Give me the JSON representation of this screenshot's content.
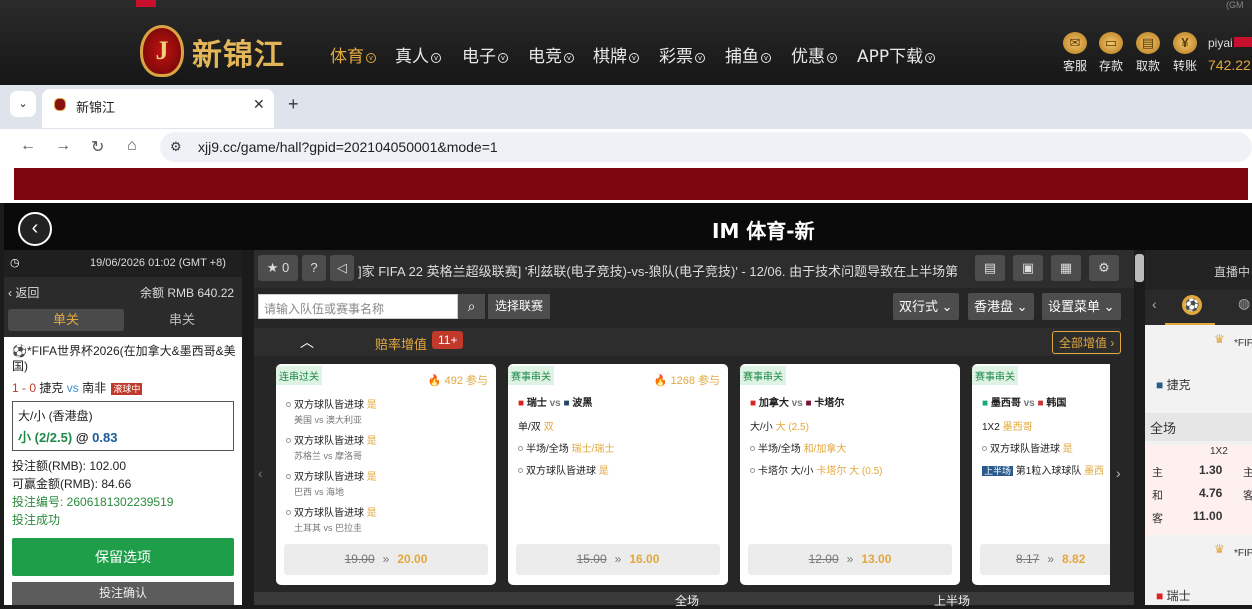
{
  "site": {
    "logo_letter": "J",
    "logo_text": "新锦江",
    "nav": [
      {
        "label": "体育"
      },
      {
        "label": "真人"
      },
      {
        "label": "电子"
      },
      {
        "label": "电竞"
      },
      {
        "label": "棋牌"
      },
      {
        "label": "彩票"
      },
      {
        "label": "捕鱼"
      },
      {
        "label": "优惠"
      },
      {
        "label": "APP下载"
      }
    ],
    "tools": [
      {
        "label": "客服"
      },
      {
        "label": "存款"
      },
      {
        "label": "取款"
      },
      {
        "label": "转账"
      }
    ],
    "user": "piyai",
    "balance": "742.22",
    "corner": "(GM"
  },
  "browser": {
    "tab_title": "新锦江",
    "url": "xjj9.cc/game/hall?gpid=202104050001&mode=1"
  },
  "im": {
    "title": "IM 体育-新"
  },
  "left": {
    "datetime": "19/06/2026 01:02 (GMT +8)",
    "back": "返回",
    "balance": "余额 RMB 640.22",
    "tab_single": "单关",
    "tab_parlay": "串关",
    "match": "*FIFA世界杯2026(在加拿大&墨西哥&美国)",
    "score": "1 - 0",
    "home": "捷克",
    "vs": "vs",
    "away": "南非",
    "live": "滚球中",
    "market": "大/小 (香港盘)",
    "selection": "小 (2/2.5)",
    "at": "@",
    "odds": "0.83",
    "stake": "投注额(RMB): 102.00",
    "win": "可赢金额(RMB): 84.66",
    "bet_no": "投注编号: 2606181302239519",
    "status": "投注成功",
    "keep": "保留选项",
    "confirm": "投注确认"
  },
  "main": {
    "fav_count": "0",
    "marquee": "]家 FIFA 22 英格兰超级联赛] '利兹联(电子竞技)-vs-狼队(电子竞技)' - 12/06. 由于技术问题导致在上半场第",
    "search_placeholder": "请输入队伍或赛事名称",
    "league_btn": "选择联赛",
    "view_dd": "双行式",
    "odds_dd": "香港盘",
    "settings_dd": "设置菜单",
    "boost_label": "赔率增值",
    "boost_count": "11+",
    "all_boost": "全部增值",
    "cards": [
      {
        "tag": "连串过关",
        "hot": "492 参与",
        "items": [
          {
            "t": "双方球队皆进球",
            "y": "是",
            "sub": "美国 vs 澳大利亚"
          },
          {
            "t": "双方球队皆进球",
            "y": "是",
            "sub": "苏格兰 vs 摩洛哥"
          },
          {
            "t": "双方球队皆进球",
            "y": "是",
            "sub": "巴西 vs 海地"
          },
          {
            "t": "双方球队皆进球",
            "y": "是",
            "sub": "土耳其 vs 巴拉圭"
          }
        ],
        "old": "19.00",
        "new": "20.00"
      },
      {
        "tag": "赛事串关",
        "hot": "1268 参与",
        "home": "瑞士",
        "away": "波黑",
        "items": [
          {
            "t": "单/双",
            "y": "双"
          },
          {
            "t": "半场/全场",
            "y": "瑞士/瑞士"
          },
          {
            "t": "双方球队皆进球",
            "y": "是"
          }
        ],
        "old": "15.00",
        "new": "16.00"
      },
      {
        "tag": "赛事串关",
        "home": "加拿大",
        "away": "卡塔尔",
        "items": [
          {
            "t": "大/小",
            "y": "大 (2.5)"
          },
          {
            "t": "半场/全场",
            "y": "和/加拿大"
          },
          {
            "t": "卡塔尔 大/小",
            "y": "卡塔尔 大 (0.5)"
          }
        ],
        "old": "12.00",
        "new": "13.00"
      },
      {
        "tag": "赛事串关",
        "home": "墨西哥",
        "away": "韩国",
        "items": [
          {
            "t": "1X2",
            "y": "墨西哥"
          },
          {
            "t": "双方球队皆进球",
            "y": "是"
          },
          {
            "t": "第1粒入球球队",
            "y": "墨西",
            "badge": "上半场"
          }
        ],
        "old": "8.17",
        "new": "8.82"
      }
    ],
    "foot_full": "全场",
    "foot_half": "上半场"
  },
  "right": {
    "live": "直播中",
    "league1": "*FIF",
    "team1": "捷克",
    "full": "全场",
    "col": "1X2",
    "rows": [
      {
        "k": "主",
        "v": "1.30",
        "k2": "主"
      },
      {
        "k": "和",
        "v": "4.76",
        "k2": "客"
      },
      {
        "k": "客",
        "v": "11.00"
      }
    ],
    "league2": "*FIF",
    "team2": "瑞士"
  }
}
